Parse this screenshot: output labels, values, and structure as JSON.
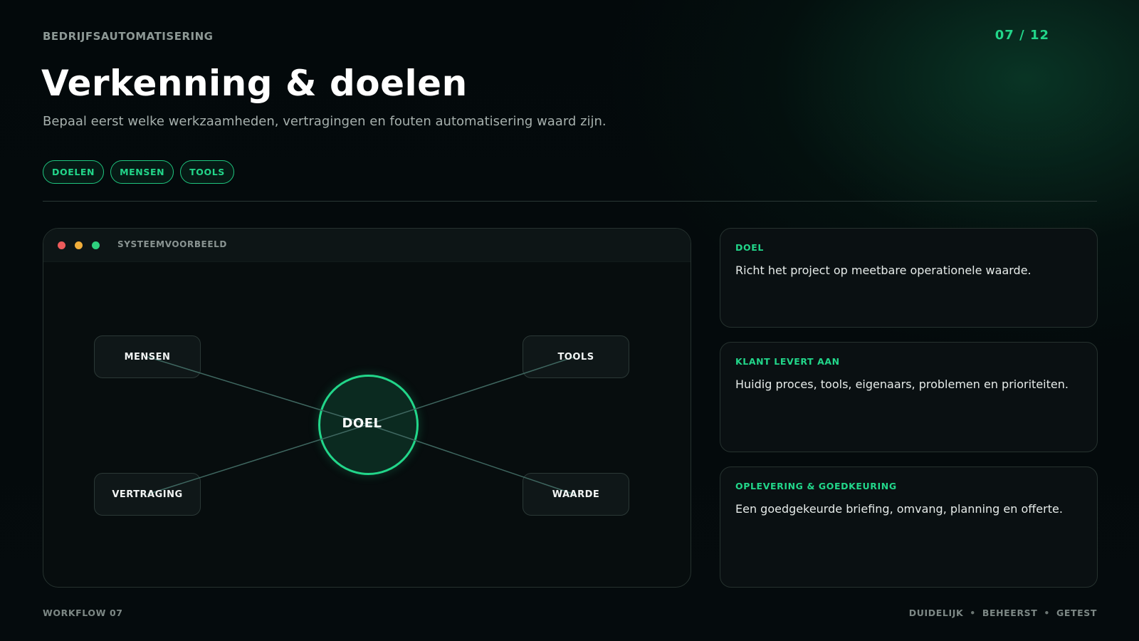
{
  "header": {
    "eyebrow": "BEDRIJFSAUTOMATISERING",
    "page_counter": "07 / 12",
    "title": "Verkenning & doelen",
    "subtitle": "Bepaal eerst welke werkzaamheden, vertragingen en fouten automatisering waard zijn."
  },
  "tags": [
    "DOELEN",
    "MENSEN",
    "TOOLS"
  ],
  "system_panel": {
    "label": "SYSTEEMVOORBEELD",
    "center_node": "DOEL",
    "nodes": [
      "MENSEN",
      "TOOLS",
      "VERTRAGING",
      "WAARDE"
    ],
    "colors": {
      "accent": "#22d68a",
      "dot_red": "#ec5b5b",
      "dot_yellow": "#f0ad3a",
      "dot_green": "#2ed07e"
    }
  },
  "cards": [
    {
      "label": "DOEL",
      "text": "Richt het project op meetbare operationele waarde."
    },
    {
      "label": "KLANT LEVERT AAN",
      "text": "Huidig proces, tools, eigenaars, problemen en prioriteiten."
    },
    {
      "label": "OPLEVERING & GOEDKEURING",
      "text": "Een goedgekeurde briefing, omvang, planning en offerte."
    }
  ],
  "footer": {
    "left": "WORKFLOW 07",
    "right": [
      "DUIDELIJK",
      "BEHEERST",
      "GETEST"
    ],
    "separator": "•"
  }
}
